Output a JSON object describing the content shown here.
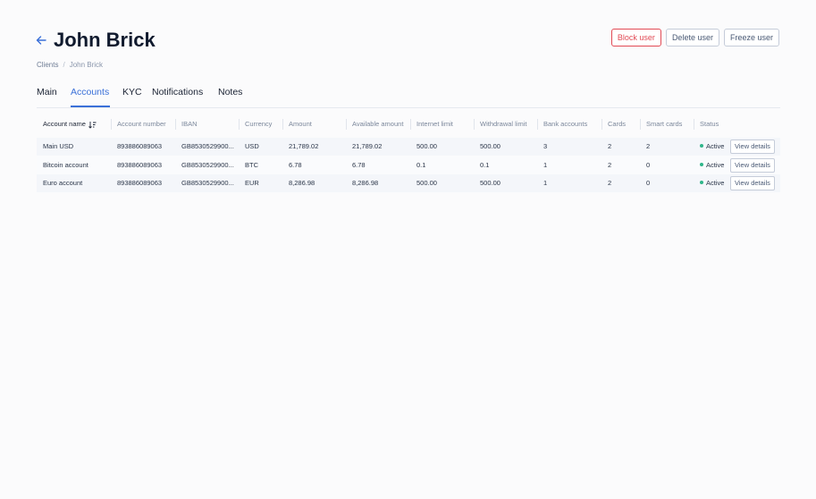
{
  "page": {
    "title": "John Brick"
  },
  "actions": {
    "block": "Block user",
    "delete": "Delete user",
    "freeze": "Freeze user"
  },
  "breadcrumb": {
    "root": "Clients",
    "sep": "/",
    "current": "John Brick"
  },
  "tabs": [
    "Main",
    "Accounts",
    "KYC",
    "Notifications",
    "Notes"
  ],
  "active_tab": "Accounts",
  "table": {
    "columns": [
      "Account name",
      "Account number",
      "IBAN",
      "Currency",
      "Amount",
      "Available amount",
      "Internet limit",
      "Withdrawal limit",
      "Bank accounts",
      "Cards",
      "Smart cards",
      "Status"
    ],
    "view_label": "View details",
    "rows": [
      {
        "name": "Main USD",
        "number": "893886089063",
        "iban": "GB8530529900...",
        "currency": "USD",
        "amount": "21,789.02",
        "available": "21,789.02",
        "internet": "500.00",
        "withdrawal": "500.00",
        "bank_accounts": "3",
        "cards": "2",
        "smart_cards": "2",
        "status": "Active"
      },
      {
        "name": "Bitcoin account",
        "number": "893886089063",
        "iban": "GB8530529900...",
        "currency": "BTC",
        "amount": "6.78",
        "available": "6.78",
        "internet": "0.1",
        "withdrawal": "0.1",
        "bank_accounts": "1",
        "cards": "2",
        "smart_cards": "0",
        "status": "Active"
      },
      {
        "name": "Euro account",
        "number": "893886089063",
        "iban": "GB8530529900...",
        "currency": "EUR",
        "amount": "8,286.98",
        "available": "8,286.98",
        "internet": "500.00",
        "withdrawal": "500.00",
        "bank_accounts": "1",
        "cards": "2",
        "smart_cards": "0",
        "status": "Active"
      }
    ]
  },
  "colors": {
    "accent": "#3a70d8",
    "danger": "#e24a55",
    "active": "#2fb68a"
  },
  "icons": {
    "back": "arrow-left-icon",
    "sort": "sort-icon"
  }
}
